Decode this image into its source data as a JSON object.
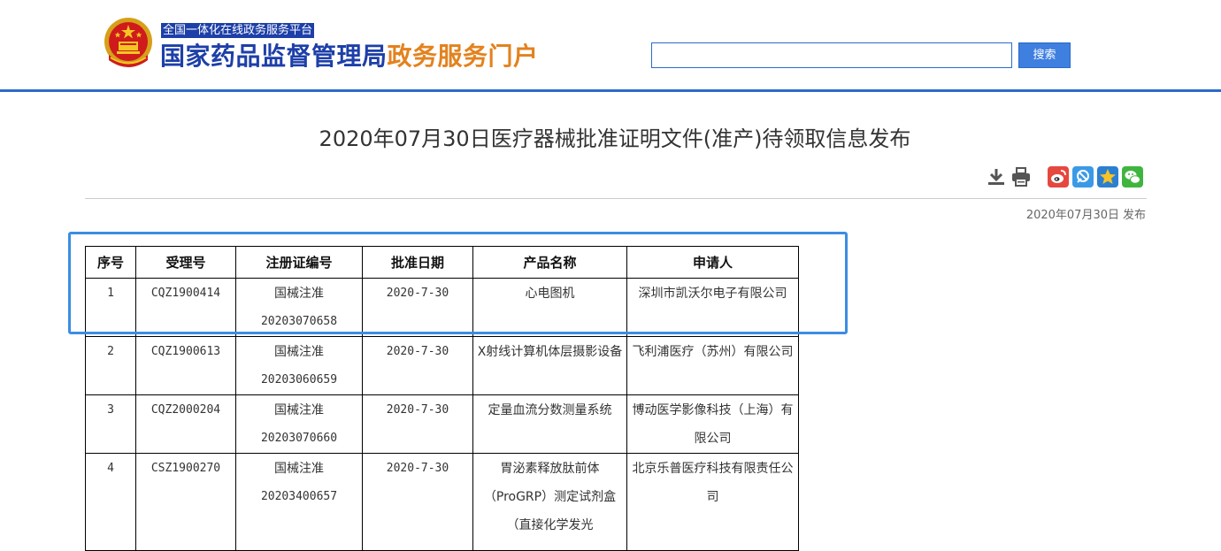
{
  "header": {
    "subtitle": "全国一体化在线政务服务平台",
    "title_main": "国家药品监督管理局",
    "title_accent": "政务服务门户",
    "search": {
      "value": "",
      "placeholder": ""
    },
    "search_button": "搜索",
    "colors": {
      "brand_blue": "#1d3fa8",
      "accent_orange": "#e3821e",
      "rule_blue": "#2a6bc9"
    }
  },
  "article": {
    "title": "2020年07月30日医疗器械批准证明文件(准产)待领取信息发布",
    "date": "2020年07月30日",
    "date_suffix": "发布",
    "tools": [
      "download-icon",
      "print-icon",
      "weibo-icon",
      "qzone-icon",
      "favorite-star-icon",
      "wechat-icon"
    ]
  },
  "table": {
    "headers": [
      "序号",
      "受理号",
      "注册证编号",
      "批准日期",
      "产品名称",
      "申请人"
    ],
    "rows": [
      {
        "no": "1",
        "accept_no": "CQZ1900414",
        "reg_line1": "国械注准",
        "reg_line2": "20203070658",
        "date": "2020-7-30",
        "product": "心电图机",
        "applicant": "深圳市凯沃尔电子有限公司"
      },
      {
        "no": "2",
        "accept_no": "CQZ1900613",
        "reg_line1": "国械注准",
        "reg_line2": "20203060659",
        "date": "2020-7-30",
        "product": "X射线计算机体层摄影设备",
        "applicant": "飞利浦医疗（苏州）有限公司"
      },
      {
        "no": "3",
        "accept_no": "CQZ2000204",
        "reg_line1": "国械注准",
        "reg_line2": "20203070660",
        "date": "2020-7-30",
        "product": "定量血流分数测量系统",
        "applicant": "博动医学影像科技（上海）有限公司"
      },
      {
        "no": "4",
        "accept_no": "CSZ1900270",
        "reg_line1": "国械注准",
        "reg_line2": "20203400657",
        "date": "2020-7-30",
        "product": "胃泌素释放肽前体（ProGRP）测定试剂盒（直接化学发光",
        "applicant": "北京乐普医疗科技有限责任公司"
      }
    ]
  }
}
